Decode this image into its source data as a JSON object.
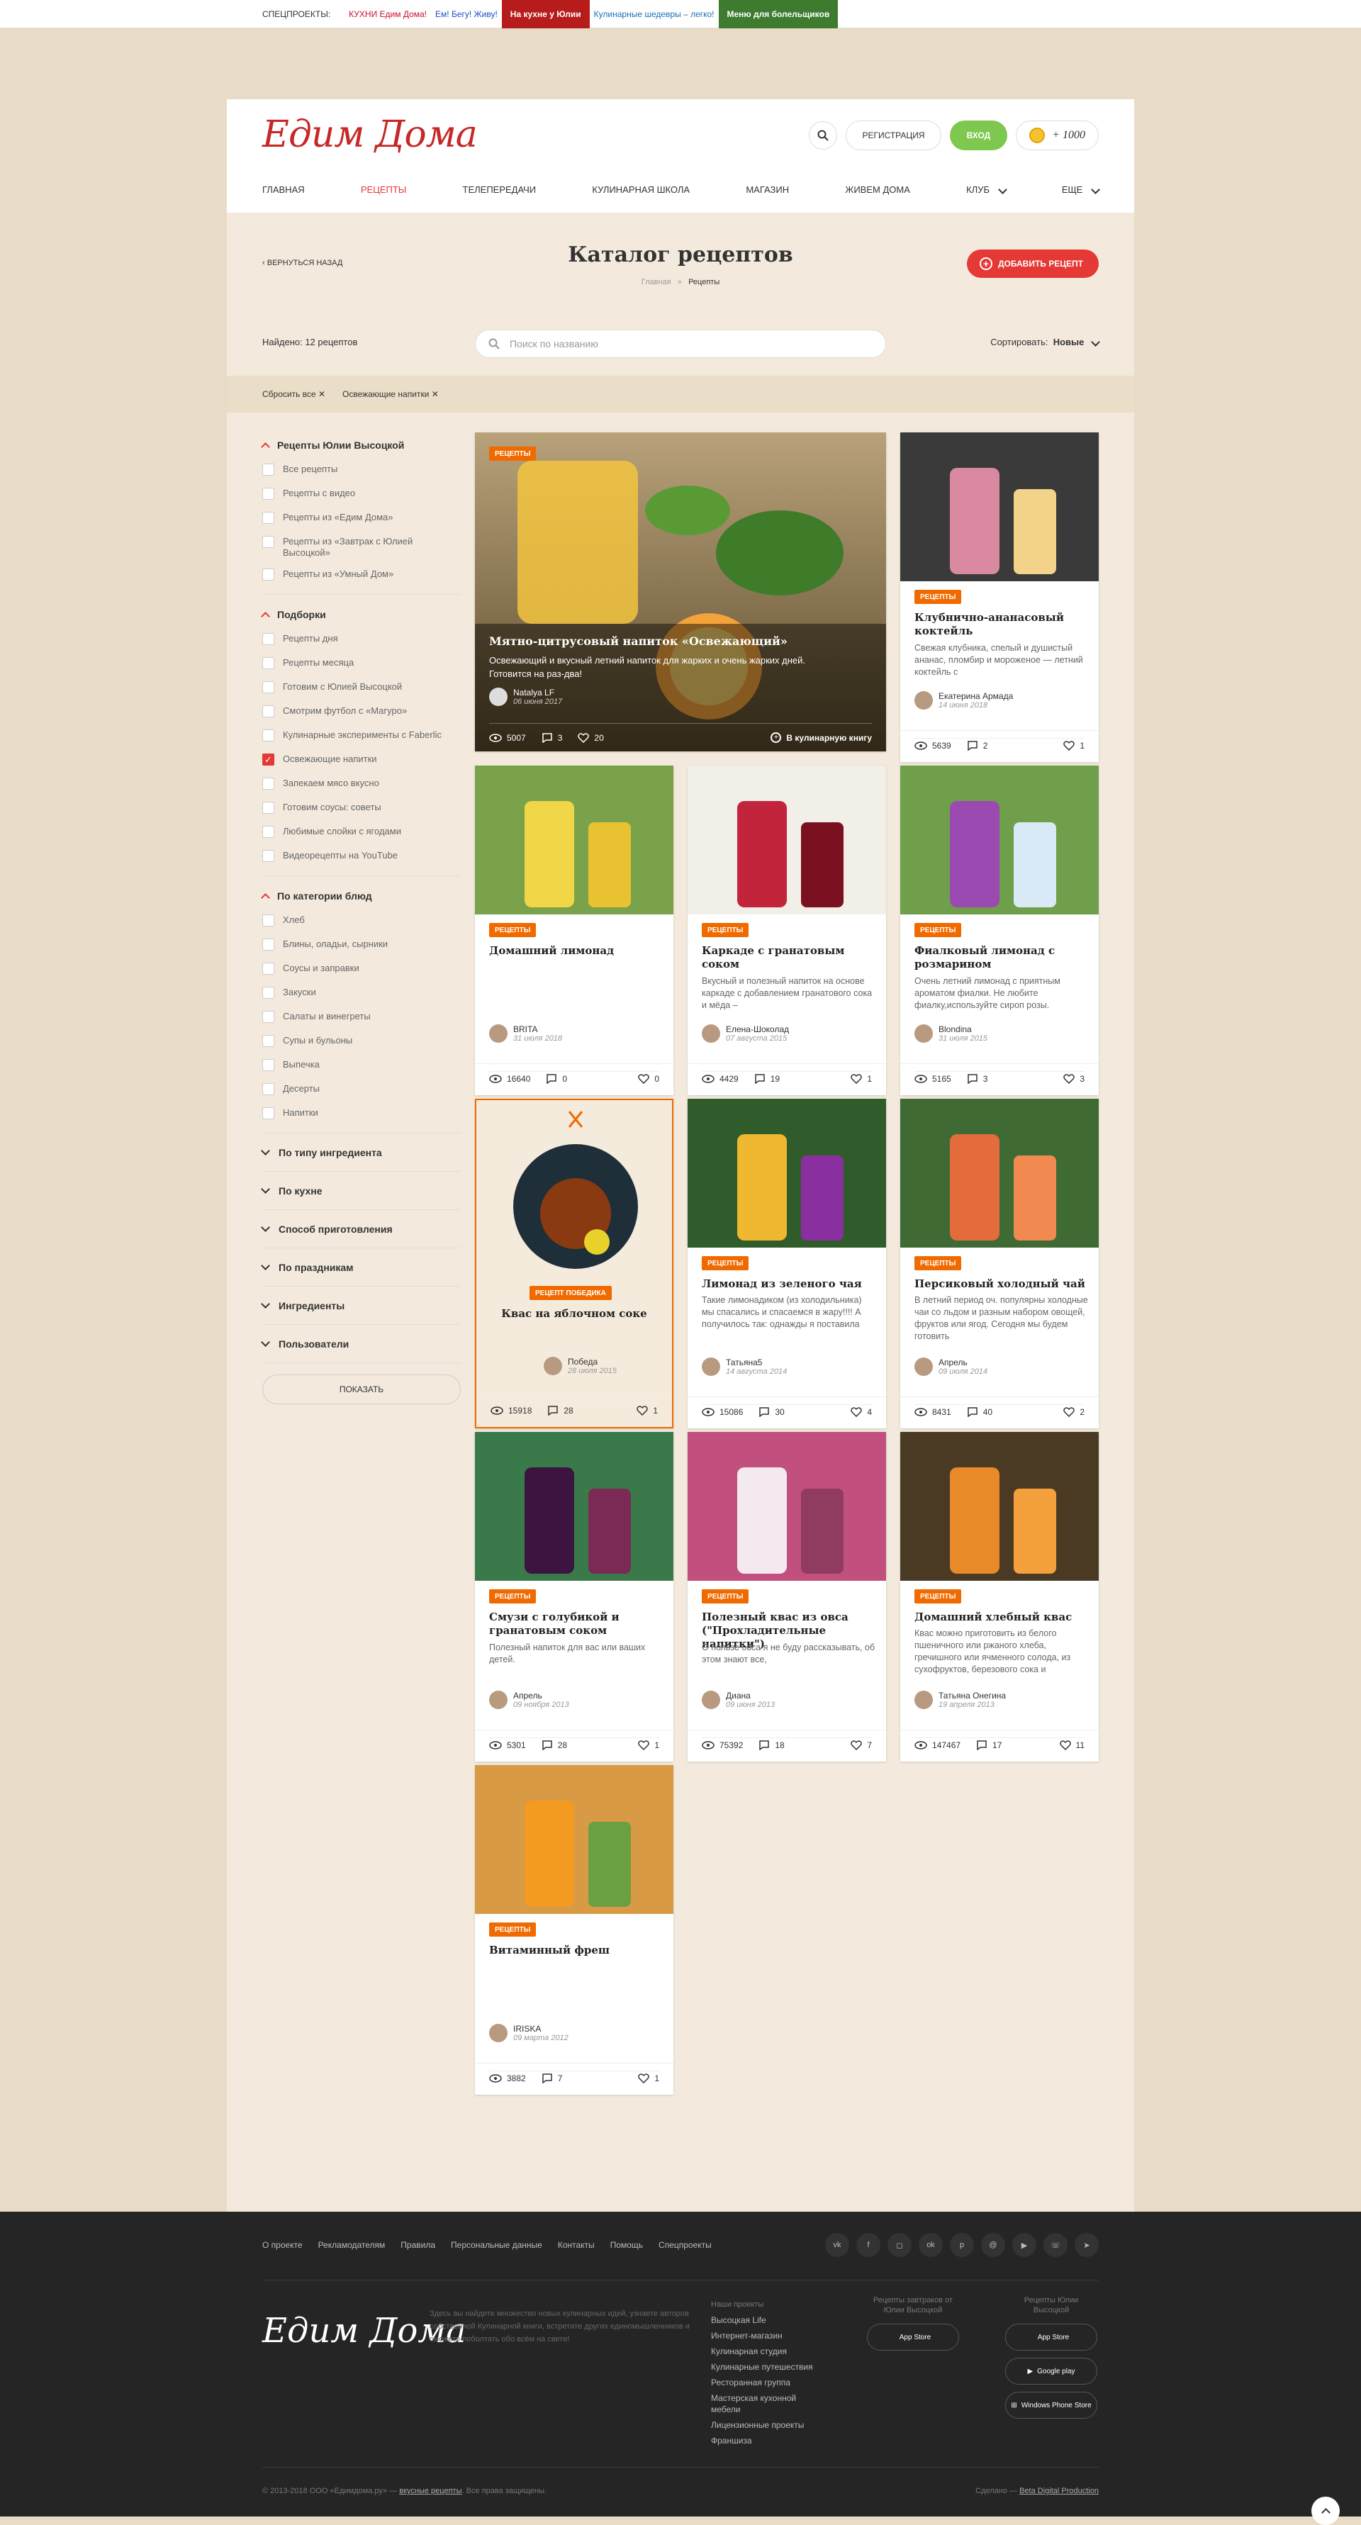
{
  "topbar": {
    "label": "СПЕЦПРОЕКТЫ:",
    "projects": [
      "КУХНИ Едим Дома!",
      "Ем! Бегу! Живу!",
      "На кухне у Юлии",
      "Кулинарные шедевры – легко!",
      "Меню для болельщиков"
    ]
  },
  "header": {
    "logo": "Едим Дома",
    "register": "РЕГИСТРАЦИЯ",
    "login": "ВХОД",
    "coins": "+ 1000",
    "nav": [
      "ГЛАВНАЯ",
      "РЕЦЕПТЫ",
      "ТЕЛЕПЕРЕДАЧИ",
      "КУЛИНАРНАЯ ШКОЛА",
      "МАГАЗИН",
      "ЖИВЕМ ДОМА",
      "КЛУБ",
      "ЕЩЕ"
    ]
  },
  "page": {
    "back": "ВЕРНУТЬСЯ НАЗАД",
    "title": "Каталог рецептов",
    "crumb_home": "Главная",
    "crumb_sep": "»",
    "crumb_current": "Рецепты",
    "add_recipe": "ДОБАВИТЬ РЕЦЕПТ",
    "found": "Найдено: 12 рецептов",
    "search_placeholder": "Поиск по названию",
    "sort_label": "Сортировать:",
    "sort_value": "Новые",
    "chip_reset": "Сбросить все",
    "chip_filter": "Освежающие напитки"
  },
  "sidebar": {
    "group1": {
      "title": "Рецепты Юлии Высоцкой",
      "items": [
        "Все рецепты",
        "Рецепты с видео",
        "Рецепты из «Едим Дома»",
        "Рецепты из «Завтрак с Юлией Высоцкой»",
        "Рецепты из «Умный Дом»"
      ]
    },
    "group2": {
      "title": "Подборки",
      "items": [
        "Рецепты дня",
        "Рецепты месяца",
        "Готовим с Юлией Высоцкой",
        "Смотрим футбол с «Магуро»",
        "Кулинарные эксперименты с Faberlic",
        "Освежающие напитки",
        "Запекаем мясо вкусно",
        "Готовим соусы: советы",
        "Любимые слойки с ягодами",
        "Видеорецепты на YouTube"
      ]
    },
    "group3": {
      "title": "По категории блюд",
      "items": [
        "Хлеб",
        "Блины, оладьи, сырники",
        "Соусы и заправки",
        "Закуски",
        "Салаты и винегреты",
        "Супы и бульоны",
        "Выпечка",
        "Десерты",
        "Напитки"
      ]
    },
    "closed": [
      "По типу ингредиента",
      "По кухне",
      "Способ приготовления",
      "По праздникам",
      "Ингредиенты",
      "Пользователи"
    ],
    "show": "ПОКАЗАТЬ"
  },
  "badge": "РЕЦЕПТЫ",
  "duel_badge": "РЕЦЕПТ ПОБЕДИКА",
  "featured": {
    "title": "Мятно-цитрусовый напиток «Освежающий»",
    "desc": "Освежающий и вкусный летний напиток для жарких и очень жарких дней. Готовится на раз-два!",
    "author": "Natalya LF",
    "date": "06 июня 2017",
    "views": "5007",
    "comments": "3",
    "likes": "20",
    "book": "В кулинарную книгу"
  },
  "cards": [
    {
      "title": "Клубнично-ананасовый коктейль",
      "desc": "Свежая клубника, спелый и душистый ананас, пломбир и мороженое — летний коктейль с",
      "author": "Екатерина Армада",
      "date": "14 июня 2018",
      "views": "5639",
      "comments": "2",
      "likes": "1"
    },
    {
      "title": "Домашний лимонад",
      "desc": "",
      "author": "BRITA",
      "date": "31 июля 2018",
      "views": "16640",
      "comments": "0",
      "likes": "0"
    },
    {
      "title": "Каркаде с гранатовым соком",
      "desc": "Вкусный и полезный напиток на основе каркаде с добавлением гранатового сока и мёда –",
      "author": "Елена-Шоколад",
      "date": "07 августа 2015",
      "views": "4429",
      "comments": "19",
      "likes": "1"
    },
    {
      "title": "Фиалковый лимонад с розмарином",
      "desc": "Очень летний лимонад с приятным ароматом фиалки. Не любите фиалку,используйте сироп розы.",
      "author": "Blondina",
      "date": "31 июля 2015",
      "views": "5165",
      "comments": "3",
      "likes": "3"
    },
    {
      "title": "Квас на яблочном соке",
      "desc": "",
      "author": "Победа",
      "date": "28 июля 2015",
      "views": "15918",
      "comments": "28",
      "likes": "1"
    },
    {
      "title": "Лимонад из зеленого чая",
      "desc": "Такие лимонадиком (из холодильника) мы спасались и спасаемся в жару!!!! А получилось так: однажды я поставила",
      "author": "Татьяна5",
      "date": "14 августа 2014",
      "views": "15086",
      "comments": "30",
      "likes": "4"
    },
    {
      "title": "Персиковый холодный чай",
      "desc": "В летний период оч. популярны холодные чаи со льдом и разным набором овощей, фруктов или ягод. Сегодня мы будем готовить",
      "author": "Апрель",
      "date": "09 июля 2014",
      "views": "8431",
      "comments": "40",
      "likes": "2"
    },
    {
      "title": "Смузи с голубикой и гранатовым соком",
      "desc": "Полезный напиток для вас или ваших детей.",
      "author": "Апрель",
      "date": "09 ноября 2013",
      "views": "5301",
      "comments": "28",
      "likes": "1"
    },
    {
      "title": "Полезный квас из овса (\"Прохладительные напитки\")",
      "desc": "О пользе овса я не буду рассказывать, об этом знают все,",
      "author": "Диана",
      "date": "09 июня 2013",
      "views": "75392",
      "comments": "18",
      "likes": "7"
    },
    {
      "title": "Домашний хлебный квас",
      "desc": "Квас можно приготовить из белого пшеничного или ржаного хлеба, гречишного или ячменного солода, из сухофруктов, березового сока и",
      "author": "Татьяна Онегина",
      "date": "19 апреля 2013",
      "views": "147467",
      "comments": "17",
      "likes": "11"
    },
    {
      "title": "Витаминный фреш",
      "desc": "",
      "author": "IRISKA",
      "date": "09 марта 2012",
      "views": "3882",
      "comments": "7",
      "likes": "1"
    }
  ],
  "footer": {
    "nav": [
      "О проекте",
      "Рекламодателям",
      "Правила",
      "Персональные данные",
      "Контакты",
      "Помощь",
      "Спецпроекты"
    ],
    "logo": "Едим Дома",
    "desc": "Здесь вы найдете множество новых кулинарных идей, узнаете авторов собственной Кулинарной книги, встретите других единомышленников и сможете поболтать обо всём на свете!",
    "projects_title": "Наши проекты",
    "projects": [
      "Высоцкая Life",
      "Интернет-магазин",
      "Кулинарная студия",
      "Кулинарные путешествия",
      "Ресторанная группа",
      "Мастерская кухонной мебели",
      "Лицензионные проекты",
      "Франшиза"
    ],
    "apps_title_1": "Рецепты завтраков от Юлии Высоцкой",
    "apps_title_2": "Рецепты Юлии Высоцкой",
    "store_app": "App Store",
    "store_google": "Google play",
    "store_windows": "Windows Phone Store",
    "copyright": "© 2013-2018 ООО «Едимдома.ру» — ",
    "copyright_link": "вкусные рецепты",
    "copyright_tail": ". Все права защищены.",
    "made_by": "Сделано — ",
    "made_link": "Beta Digital Production"
  }
}
